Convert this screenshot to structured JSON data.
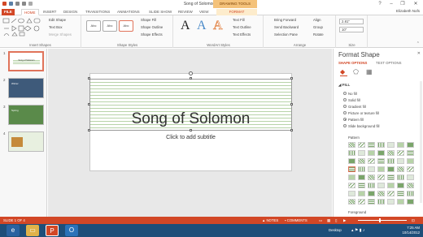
{
  "window": {
    "title": "Song of Solomon - PowerPoint",
    "contextual_tab_group": "DRAWING TOOLS",
    "help_icon": "?",
    "minimize": "–",
    "restore": "❐",
    "close": "✕"
  },
  "user": "Elizabeth Nofs",
  "tabs": [
    "FILE",
    "HOME",
    "INSERT",
    "DESIGN",
    "TRANSITIONS",
    "ANIMATIONS",
    "SLIDE SHOW",
    "REVIEW",
    "VIEW",
    "FORMAT"
  ],
  "ribbon": {
    "insert_shapes": {
      "label": "Insert Shapes",
      "edit_shape": "Edit Shape",
      "text_box": "Text Box",
      "merge_shapes": "Merge Shapes"
    },
    "shape_styles": {
      "label": "Shape Styles",
      "presets": [
        "Abc",
        "Abc",
        "Abc"
      ],
      "shape_fill": "Shape Fill",
      "shape_outline": "Shape Outline",
      "shape_effects": "Shape Effects"
    },
    "wordart_styles": {
      "label": "WordArt Styles",
      "samples": [
        "A",
        "A",
        "A"
      ],
      "text_fill": "Text Fill",
      "text_outline": "Text Outline",
      "text_effects": "Text Effects"
    },
    "arrange": {
      "label": "Arrange",
      "bring_forward": "Bring Forward",
      "send_backward": "Send Backward",
      "selection_pane": "Selection Pane",
      "align": "Align",
      "group": "Group",
      "rotate": "Rotate"
    },
    "size": {
      "label": "Size",
      "height": "2.81\"",
      "width": "10\""
    }
  },
  "thumbnails": {
    "numbers": [
      "1",
      "2",
      "3",
      "4"
    ],
    "titles": [
      "Song of Solomon",
      "Winter",
      "Spring",
      ""
    ]
  },
  "slide": {
    "title": "Song of Solomon",
    "subtitle_placeholder": "Click to add subtitle"
  },
  "format_pane": {
    "title": "Format Shape",
    "tabs": [
      "SHAPE OPTIONS",
      "TEXT OPTIONS"
    ],
    "fill_header": "FILL",
    "fill_options": [
      "No fill",
      "Solid fill",
      "Gradient fill",
      "Picture or texture fill",
      "Pattern fill",
      "Slide background fill"
    ],
    "selected_fill": "Pattern fill",
    "pattern_label": "Pattern",
    "foreground_label": "Foreground"
  },
  "statusbar": {
    "slide_info": "SLIDE 1 OF 4",
    "notes": "NOTES",
    "comments": "COMMENTS"
  },
  "taskbar": {
    "desktop": "Desktop",
    "time": "7:25 AM",
    "date": "10/14/2012"
  },
  "colors": {
    "accent": "#d24726",
    "pattern_line": "#b7d3a8",
    "taskbar": "#1e4e79"
  }
}
